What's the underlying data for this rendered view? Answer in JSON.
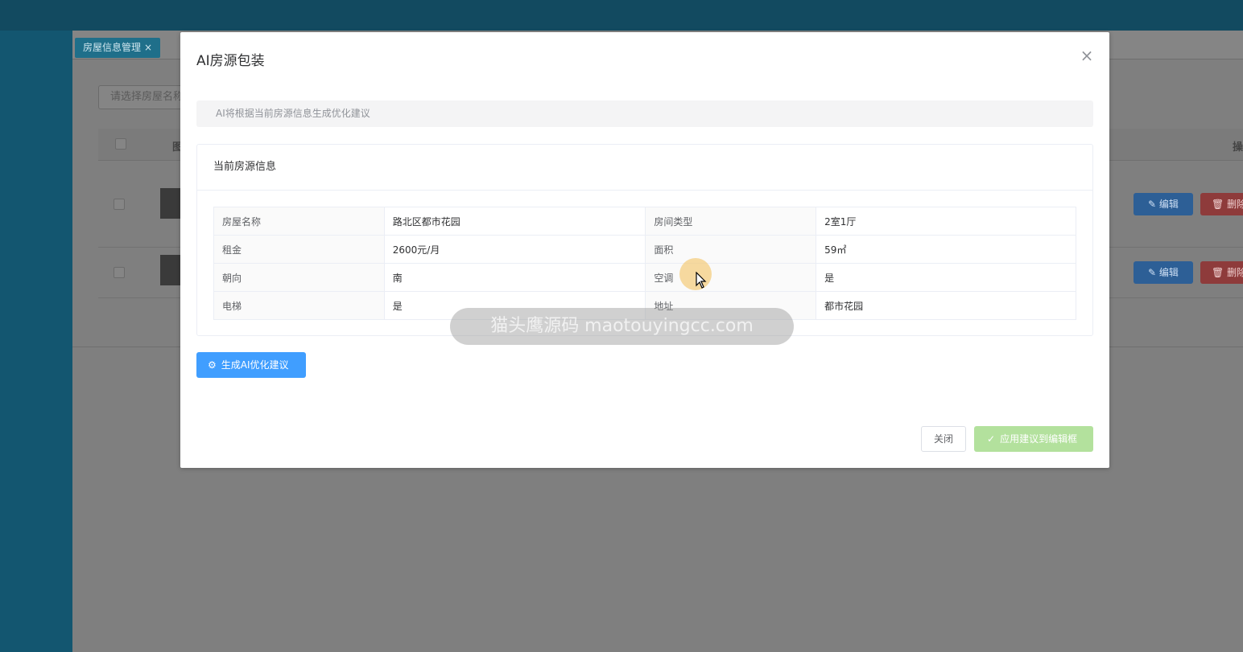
{
  "background": {
    "tab": {
      "label": "房屋信息管理",
      "close": "×"
    },
    "search_placeholder": "请选择房屋名称",
    "table_header": {
      "col_image": "图",
      "col_actions": "操"
    },
    "rows": [
      {
        "edit_label": "编辑",
        "delete_label": "删除"
      },
      {
        "edit_label": "编辑",
        "delete_label": "删除"
      }
    ]
  },
  "modal": {
    "title": "AI房源包装",
    "close_icon": "×",
    "alert_text": "AI将根据当前房源信息生成优化建议",
    "card_title": "当前房源信息",
    "info": [
      {
        "label1": "房屋名称",
        "value1": "路北区都市花园",
        "label2": "房间类型",
        "value2": "2室1厅"
      },
      {
        "label1": "租金",
        "value1": "2600元/月",
        "label2": "面积",
        "value2": "59㎡"
      },
      {
        "label1": "朝向",
        "value1": "南",
        "label2": "空调",
        "value2": "是"
      },
      {
        "label1": "电梯",
        "value1": "是",
        "label2": "地址",
        "value2": "都市花园"
      }
    ],
    "generate_button": "生成AI优化建议",
    "close_button": "关闭",
    "apply_button": "应用建议到编辑框"
  },
  "watermark": "猫头鹰源码 maotouyingcc.com",
  "colors": {
    "primary": "#409eff",
    "success_disabled": "#b3e19d",
    "topbar": "#124a60",
    "sidebar": "#135670"
  }
}
